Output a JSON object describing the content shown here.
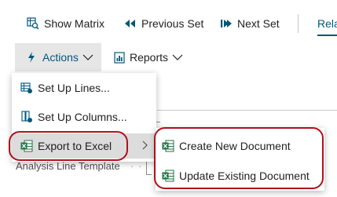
{
  "toolbar": {
    "show_matrix": "Show Matrix",
    "previous_set": "Previous Set",
    "next_set": "Next Set",
    "related": "Rela",
    "actions": "Actions",
    "reports": "Reports"
  },
  "menu": {
    "items": [
      {
        "label": "Set Up Lines...",
        "icon": "lines-setup-icon"
      },
      {
        "label": "Set Up Columns...",
        "icon": "columns-setup-icon"
      },
      {
        "label": "Export to Excel",
        "icon": "excel-icon",
        "has_submenu": true
      }
    ]
  },
  "submenu": {
    "items": [
      {
        "label": "Create New Document",
        "icon": "excel-icon"
      },
      {
        "label": "Update Existing Document",
        "icon": "excel-icon"
      }
    ]
  },
  "page": {
    "analysis_line_template_label": "Analysis Line Template",
    "dots": "· ·"
  },
  "colors": {
    "accent": "#00587a",
    "highlight_outline": "#b0101c",
    "excel_green": "#217346"
  }
}
